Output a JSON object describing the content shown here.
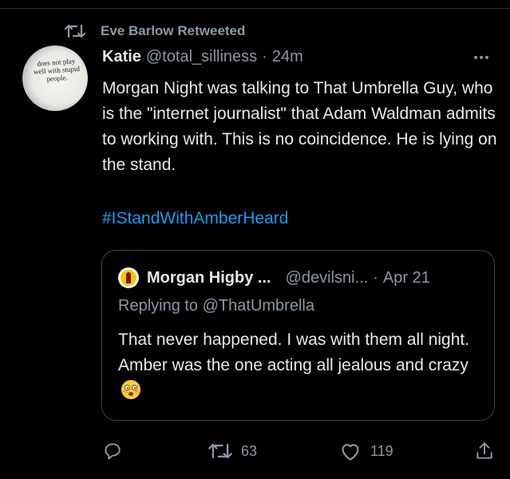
{
  "retweet_banner": {
    "label": "Eve Barlow Retweeted",
    "icon": "retweet-icon"
  },
  "tweet": {
    "avatar_text": "does not play well with stupid people.",
    "author_name": "Katie",
    "author_handle": "@total_silliness",
    "separator": "·",
    "time": "24m",
    "text": "Morgan Night was talking to That Umbrella Guy, who is the \"internet journalist\" that Adam Waldman admits to working with. This is no coincidence. He is lying on the stand.",
    "hashtag": "#IStandWithAmberHeard"
  },
  "quoted_tweet": {
    "author_name": "Morgan Higby ...",
    "author_handle": "@devilsni...",
    "separator": "·",
    "time": "Apr 21",
    "replying_prefix": "Replying to",
    "replying_to": "@ThatUmbrella",
    "text": "That never happened. I was with them all night. Amber was the one acting all jealous and crazy",
    "emoji": "flushed-face"
  },
  "actions": {
    "reply": {
      "icon": "reply-icon",
      "count": ""
    },
    "retweet": {
      "icon": "retweet-icon",
      "count": "63"
    },
    "like": {
      "icon": "heart-icon",
      "count": "119"
    },
    "share": {
      "icon": "share-icon",
      "count": ""
    }
  },
  "colors": {
    "background": "#000000",
    "text": "#e7e9ea",
    "muted": "#8b98a5",
    "link": "#1d9bf0",
    "border": "#3e4144"
  }
}
